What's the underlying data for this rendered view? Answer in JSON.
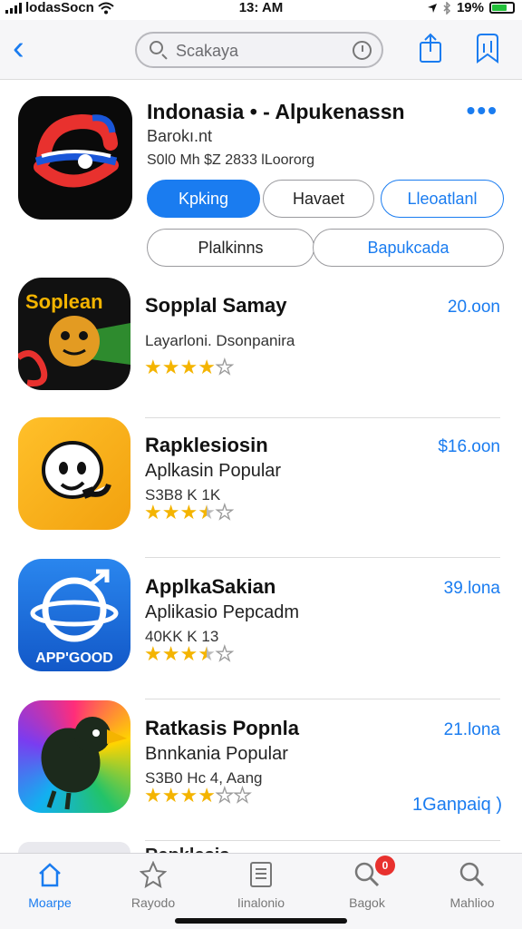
{
  "status_bar": {
    "carrier": "lodasSocn",
    "time": "13: AM",
    "battery": "19%"
  },
  "navbar": {
    "search_text": "Scakaya"
  },
  "featured": {
    "title": "Indonasia • - Alpukenassn",
    "subtitle": "Barokı.nt",
    "meta": "S0l0 Mh $Z 2833 lLoororg",
    "buttons": [
      "Kpking",
      "Havaet",
      "Lleoatlanl"
    ],
    "segment": [
      "Plalkinns",
      "Bapukcada"
    ]
  },
  "apps": [
    {
      "name": "Sopplal Samay",
      "line2": "Layarloni. Dsonpanira",
      "line3": "",
      "price": "20.oon",
      "rating": 4,
      "max": 5,
      "icon": "cartoon-character-icon",
      "icon_text": "Soplean",
      "action": ""
    },
    {
      "name": "Rapklesiosin",
      "line2": "Aplkasin Popular",
      "line3": "S3B8 K 1K",
      "price": "$16.oon",
      "rating": 3.5,
      "max": 5,
      "icon": "ghost-face-icon",
      "icon_text": "",
      "action": ""
    },
    {
      "name": "ApplkaSakian",
      "line2": "Aplikasio Pepcadm",
      "line3": "40KK K 13",
      "price": "39.lona",
      "rating": 3.5,
      "max": 5,
      "icon": "globe-arrow-icon",
      "icon_text": "APP'GOOD",
      "action": ""
    },
    {
      "name": "Ratkasis Popnla",
      "line2": "Bnnkania Popular",
      "line3": "S3B0 Hc 4, Aang",
      "price": "21.lona",
      "rating": 4,
      "max": 6,
      "icon": "crow-bird-icon",
      "icon_text": "",
      "action": "1Ganpaiq )"
    }
  ],
  "peek_name": "Rapklesis",
  "tabs": [
    {
      "label": "Moarpe",
      "icon": "home-icon",
      "active": true
    },
    {
      "label": "Rayodo",
      "icon": "star-icon",
      "active": false
    },
    {
      "label": "Iinalonio",
      "icon": "list-icon",
      "active": false
    },
    {
      "label": "Bagok",
      "icon": "search-badge-icon",
      "active": false,
      "badge": "0"
    },
    {
      "label": "Mahlioo",
      "icon": "search-icon",
      "active": false
    }
  ],
  "colors": {
    "accent": "#1a7cf0",
    "star": "#f4b400",
    "badge": "#e8312e"
  }
}
